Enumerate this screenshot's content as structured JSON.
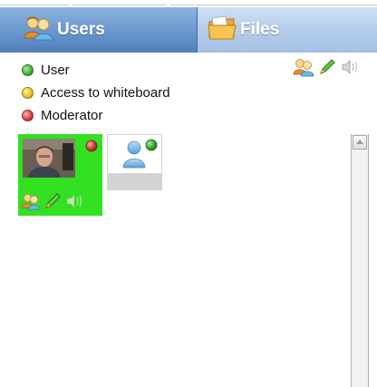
{
  "tabs": {
    "users": {
      "label": "Users",
      "icon": "users-icon",
      "active": true
    },
    "files": {
      "label": "Files",
      "icon": "folder-icon",
      "active": false
    }
  },
  "legend": [
    {
      "label": "User",
      "color": "#3fae3a"
    },
    {
      "label": "Access to whiteboard",
      "color": "#e8c21c"
    },
    {
      "label": "Moderator",
      "color": "#d8403f"
    }
  ],
  "toolbar": {
    "icons": [
      "users-icon",
      "pencil-icon",
      "speaker-icon"
    ]
  },
  "participants": [
    {
      "kind": "webcam",
      "status_color": "#d8403f",
      "highlight_color": "#33e022",
      "tools": [
        "users-icon",
        "pencil-icon",
        "speaker-icon"
      ]
    },
    {
      "kind": "guest-avatar",
      "status_color": "#3fae3a"
    }
  ],
  "colors": {
    "tab_active": "#6f9bd0",
    "tab_inactive": "#b5cdea",
    "card_highlight": "#33e022"
  }
}
